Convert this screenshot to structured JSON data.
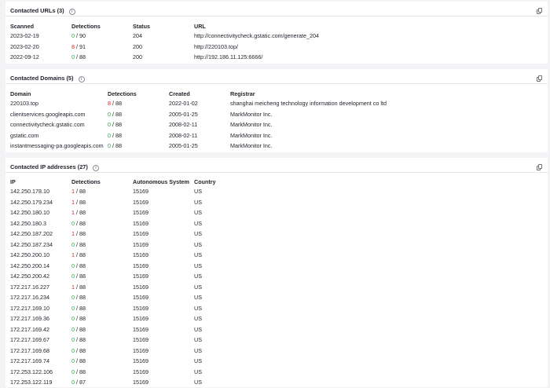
{
  "urls": {
    "title": "Contacted URLs",
    "count": "(3)",
    "headers": [
      "Scanned",
      "Detections",
      "Status",
      "URL"
    ],
    "rows": [
      {
        "scanned": "2023-02-19",
        "det": "0",
        "total": "90",
        "status": "204",
        "url": "http://connectivitycheck.gstatic.com/generate_204"
      },
      {
        "scanned": "2023-02-20",
        "det": "8",
        "total": "91",
        "status": "200",
        "url": "http://220103.top/"
      },
      {
        "scanned": "2022-09-12",
        "det": "0",
        "total": "88",
        "status": "200",
        "url": "http://192.186.11.125:6666/"
      }
    ]
  },
  "domains": {
    "title": "Contacted Domains",
    "count": "(5)",
    "headers": [
      "Domain",
      "Detections",
      "Created",
      "Registrar"
    ],
    "rows": [
      {
        "domain": "220103.top",
        "det": "8",
        "total": "88",
        "created": "2022-01-02",
        "registrar": "shanghai meicheng technology information development co ltd"
      },
      {
        "domain": "clientservices.googleapis.com",
        "det": "0",
        "total": "88",
        "created": "2005-01-25",
        "registrar": "MarkMonitor Inc."
      },
      {
        "domain": "connectivitycheck.gstatic.com",
        "det": "0",
        "total": "88",
        "created": "2008-02-11",
        "registrar": "MarkMonitor Inc."
      },
      {
        "domain": "gstatic.com",
        "det": "0",
        "total": "88",
        "created": "2008-02-11",
        "registrar": "MarkMonitor Inc."
      },
      {
        "domain": "instantmessaging-pa.googleapis.com",
        "det": "0",
        "total": "88",
        "created": "2005-01-25",
        "registrar": "MarkMonitor Inc."
      }
    ]
  },
  "ips": {
    "title": "Contacted IP addresses",
    "count": "(27)",
    "headers": [
      "IP",
      "Detections",
      "Autonomous System",
      "Country"
    ],
    "rows": [
      {
        "ip": "142.250.178.10",
        "det": "1",
        "total": "88",
        "as": "15169",
        "country": "US"
      },
      {
        "ip": "142.250.179.234",
        "det": "1",
        "total": "88",
        "as": "15169",
        "country": "US"
      },
      {
        "ip": "142.250.180.10",
        "det": "1",
        "total": "88",
        "as": "15169",
        "country": "US"
      },
      {
        "ip": "142.250.180.3",
        "det": "0",
        "total": "88",
        "as": "15169",
        "country": "US"
      },
      {
        "ip": "142.250.187.202",
        "det": "1",
        "total": "88",
        "as": "15169",
        "country": "US"
      },
      {
        "ip": "142.250.187.234",
        "det": "0",
        "total": "88",
        "as": "15169",
        "country": "US"
      },
      {
        "ip": "142.250.200.10",
        "det": "1",
        "total": "88",
        "as": "15169",
        "country": "US"
      },
      {
        "ip": "142.250.200.14",
        "det": "0",
        "total": "88",
        "as": "15169",
        "country": "US"
      },
      {
        "ip": "142.250.200.42",
        "det": "0",
        "total": "88",
        "as": "15169",
        "country": "US"
      },
      {
        "ip": "172.217.16.227",
        "det": "1",
        "total": "88",
        "as": "15169",
        "country": "US"
      },
      {
        "ip": "172.217.16.234",
        "det": "0",
        "total": "88",
        "as": "15169",
        "country": "US"
      },
      {
        "ip": "172.217.169.10",
        "det": "0",
        "total": "88",
        "as": "15169",
        "country": "US"
      },
      {
        "ip": "172.217.169.36",
        "det": "0",
        "total": "88",
        "as": "15169",
        "country": "US"
      },
      {
        "ip": "172.217.169.42",
        "det": "0",
        "total": "88",
        "as": "15169",
        "country": "US"
      },
      {
        "ip": "172.217.169.67",
        "det": "0",
        "total": "88",
        "as": "15169",
        "country": "US"
      },
      {
        "ip": "172.217.169.68",
        "det": "0",
        "total": "88",
        "as": "15169",
        "country": "US"
      },
      {
        "ip": "172.217.169.74",
        "det": "0",
        "total": "88",
        "as": "15169",
        "country": "US"
      },
      {
        "ip": "172.253.122.106",
        "det": "0",
        "total": "88",
        "as": "15169",
        "country": "US"
      },
      {
        "ip": "172.253.122.119",
        "det": "0",
        "total": "87",
        "as": "15169",
        "country": "US"
      }
    ]
  },
  "icons": {
    "info": "info-icon",
    "copy": "copy-icon"
  },
  "colors": {
    "detected": "#e21d1d",
    "clean": "#25a74a"
  }
}
